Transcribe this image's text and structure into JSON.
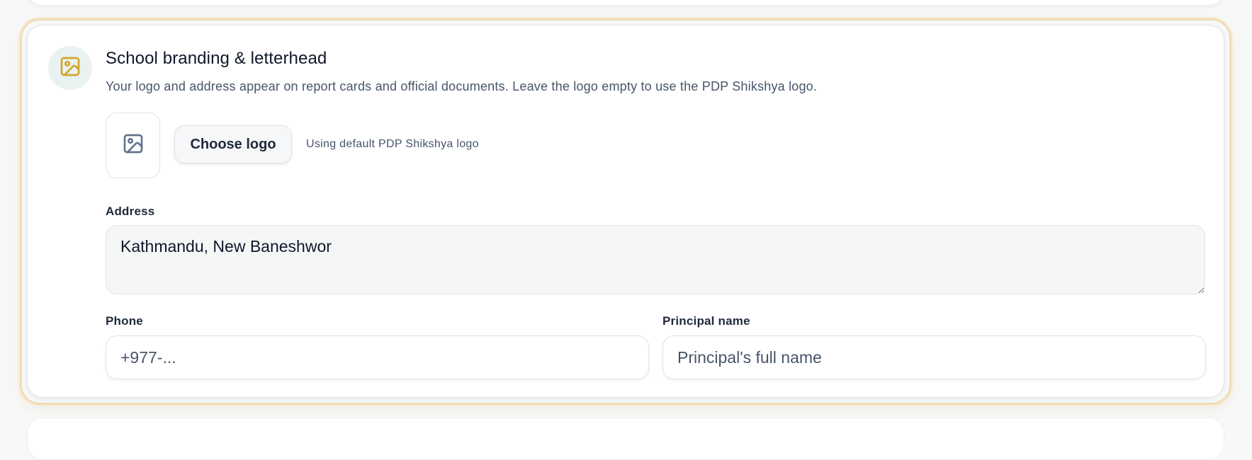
{
  "section": {
    "title": "School branding & letterhead",
    "description": "Your logo and address appear on report cards and official documents. Leave the logo empty to use the PDP Shikshya logo.",
    "icon": "image-icon",
    "accent_color": "#d4a52b"
  },
  "logo": {
    "placeholder_icon": "image-icon",
    "choose_label": "Choose logo",
    "status_text": "Using default PDP Shikshya logo"
  },
  "fields": {
    "address": {
      "label": "Address",
      "value": "Kathmandu, New Baneshwor"
    },
    "phone": {
      "label": "Phone",
      "value": "",
      "placeholder": "+977-..."
    },
    "principal": {
      "label": "Principal name",
      "value": "",
      "placeholder": "Principal's full name"
    }
  }
}
